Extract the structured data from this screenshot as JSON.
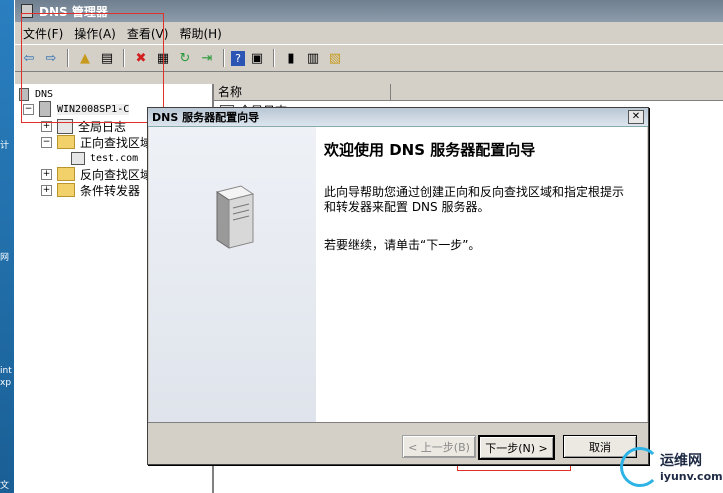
{
  "desktop": {
    "glyphs": [
      "计",
      "网",
      "int",
      "xp",
      "文"
    ]
  },
  "window": {
    "title": "DNS 管理器",
    "menu": [
      "文件(F)",
      "操作(A)",
      "查看(V)",
      "帮助(H)"
    ]
  },
  "tree": {
    "root": "DNS",
    "server": "WIN2008SP1-C",
    "items": [
      "全局日志",
      "正向查找区域",
      "test.com",
      "反向查找区域",
      "条件转发器"
    ]
  },
  "list": {
    "column_name": "名称",
    "partial_row": "全局日志"
  },
  "wizard": {
    "title": "DNS 服务器配置向导",
    "close": "✕",
    "heading": "欢迎使用 DNS 服务器配置向导",
    "body": "此向导帮助您通过创建正向和反向查找区域和指定根提示和转发器来配置 DNS 服务器。",
    "continue_text": "若要继续，请单击“下一步”。",
    "back_label": "< 上一步(B)",
    "next_label": "下一步(N) >",
    "cancel_label": "取消"
  },
  "watermark": {
    "cn": "运维网",
    "en": "iyunv.com"
  }
}
